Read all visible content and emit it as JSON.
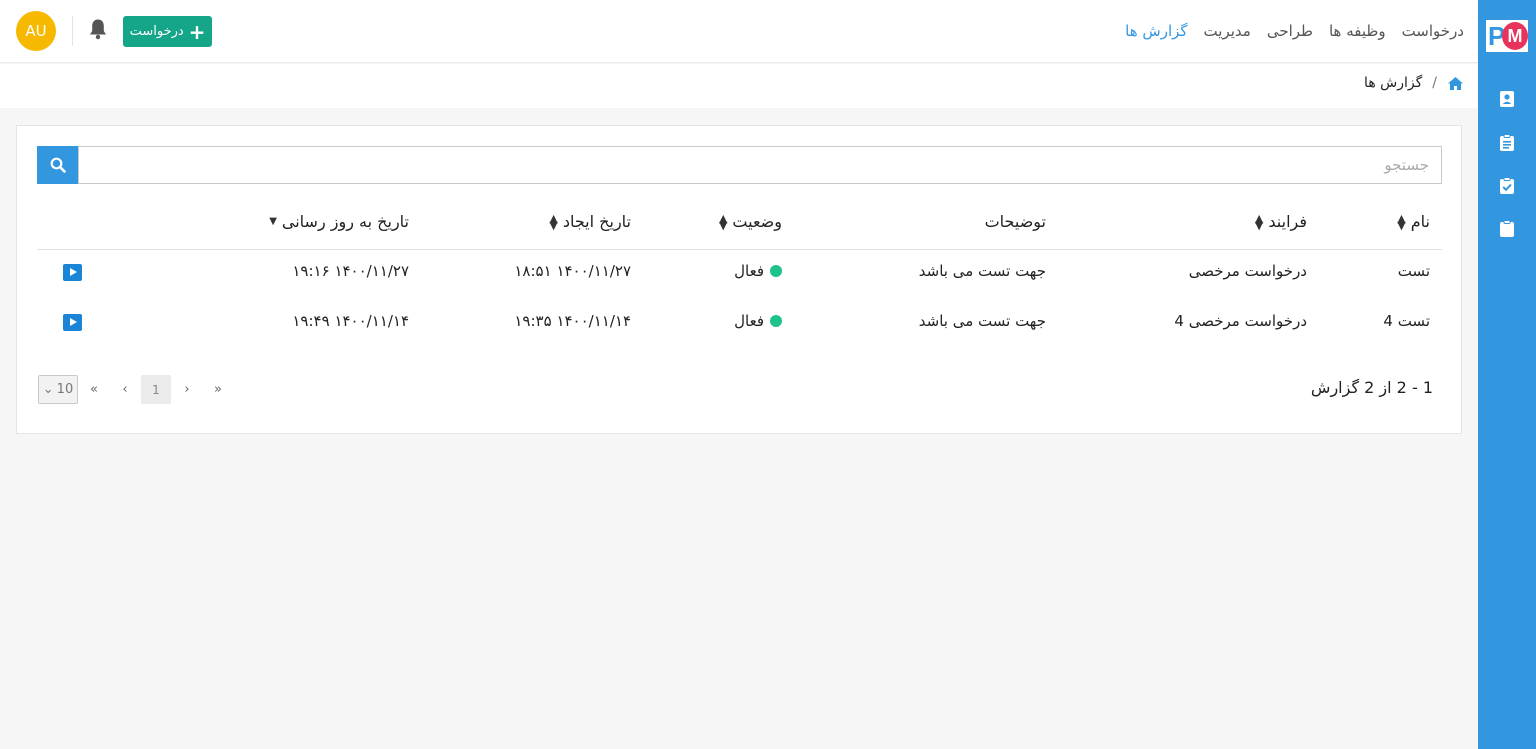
{
  "app": {
    "logo_p": "P",
    "logo_m": "M"
  },
  "nav": {
    "items": [
      {
        "label": "درخواست",
        "active": false
      },
      {
        "label": "وظیفه ها",
        "active": false
      },
      {
        "label": "طراحی",
        "active": false
      },
      {
        "label": "مدیریت",
        "active": false
      },
      {
        "label": "گزارش ها",
        "active": true
      }
    ],
    "new_request_label": "درخواست",
    "avatar_initials": "AU"
  },
  "sidebar": {
    "icons": [
      "contact-card-icon",
      "clipboard-list-icon",
      "clipboard-check-icon",
      "clipboard-icon"
    ]
  },
  "breadcrumb": {
    "home_icon": "home-icon",
    "separator": "/",
    "current": "گزارش ها"
  },
  "search": {
    "placeholder": "جستجو",
    "value": ""
  },
  "table": {
    "columns": {
      "name": "نام",
      "process": "فرایند",
      "description": "توضیحات",
      "status": "وضعیت",
      "created": "تاریخ ایجاد",
      "updated": "تاریخ به روز رسانی"
    },
    "rows": [
      {
        "name": "تست",
        "process": "درخواست مرخصی",
        "description": "جهت تست می باشد",
        "status": "فعال",
        "created": "۱۴۰۰/۱۱/۲۷ ۱۸:۵۱",
        "updated": "۱۴۰۰/۱۱/۲۷ ۱۹:۱۶"
      },
      {
        "name": "تست 4",
        "process": "درخواست مرخصی 4",
        "description": "جهت تست می باشد",
        "status": "فعال",
        "created": "۱۴۰۰/۱۱/۱۴ ۱۹:۳۵",
        "updated": "۱۴۰۰/۱۱/۱۴ ۱۹:۴۹"
      }
    ]
  },
  "pagination": {
    "info": "1 - 2 از 2 گزارش",
    "current_page": "1",
    "page_size": "10"
  },
  "colors": {
    "accent": "#3397e0",
    "success": "#15a589",
    "status_active": "#1ec38c",
    "avatar": "#f6b900"
  }
}
